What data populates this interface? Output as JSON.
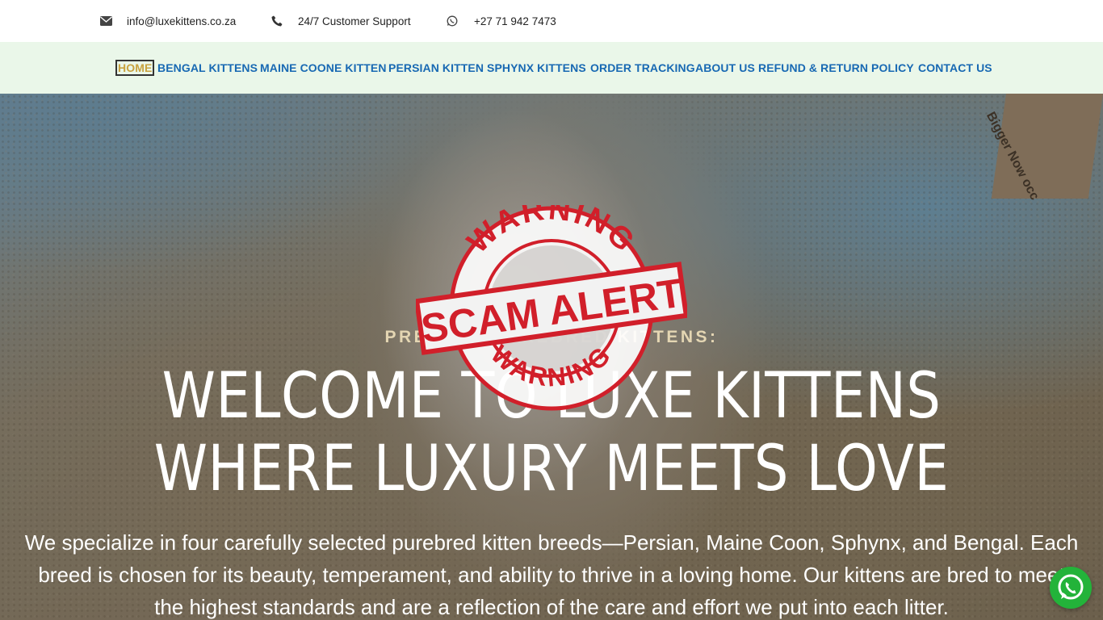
{
  "topbar": {
    "email": "info@luxekittens.co.za",
    "support": "24/7 Customer Support",
    "phone": "+27 71 942 7473",
    "icons": {
      "email": "envelope-icon",
      "support": "phone-icon",
      "phone": "whatsapp-icon"
    }
  },
  "nav": {
    "items": [
      {
        "label": "HOME",
        "active": true
      },
      {
        "label": "BENGAL KITTENS"
      },
      {
        "label": "MAINE COONE KITTEN"
      },
      {
        "label": "PERSIAN KITTEN"
      },
      {
        "label": "SPHYNX KITTENS"
      },
      {
        "label": "ORDER TRACKING"
      },
      {
        "label": "ABOUT US"
      },
      {
        "label": "REFUND & RETURN POLICY"
      },
      {
        "label": "CONTACT US"
      }
    ]
  },
  "hero": {
    "kicker": "PREMIUM PUREBRED KITTENS:",
    "title": "WELCOME TO LUXE KITTENS WHERE LUXURY MEETS LOVE",
    "description": "We specialize in four carefully selected purebred kitten breeds—Persian, Maine Coon, Sphynx, and Bengal. Each breed is chosen for its beauty, temperament, and ability to thrive in a loving home. Our kittens are bred to meet the highest standards and are a reflection of the care and effort we put into each litter.",
    "background_text": "Bigger\nNow occ"
  },
  "stamp": {
    "top": "WARNING",
    "center": "SCAM ALERT",
    "bottom": "WARNING"
  },
  "colors": {
    "nav_bg": "#eaf7e9",
    "nav_link": "#1869b3",
    "nav_active": "#c9a23f",
    "stamp_red": "#d11f2a",
    "whatsapp": "#23b33a"
  },
  "floating": {
    "whatsapp_icon": "whatsapp-icon"
  }
}
